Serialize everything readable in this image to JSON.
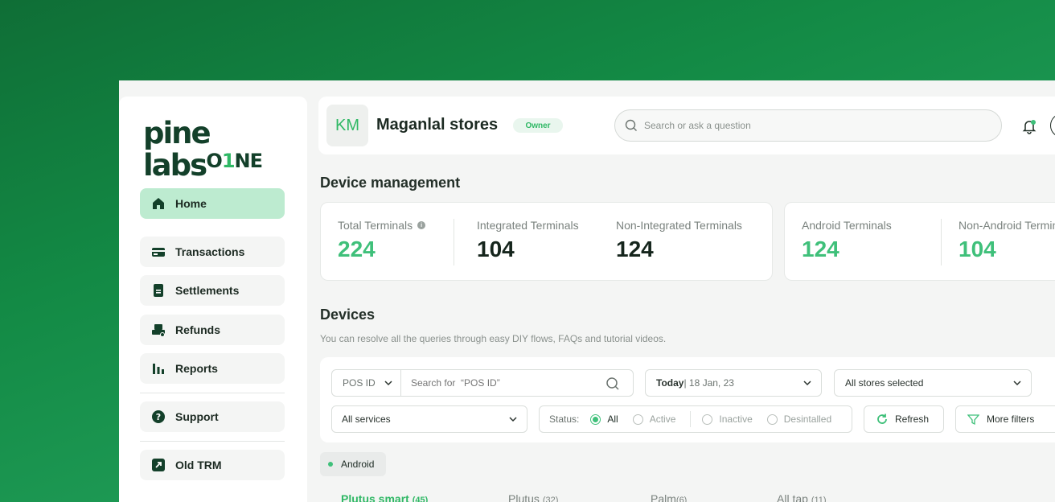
{
  "brand": {
    "logo_top": "pine labs",
    "logo_bottom_a": "O",
    "logo_bottom_b": "1",
    "logo_bottom_c": "NE"
  },
  "sidebar": {
    "items": [
      {
        "label": "Home",
        "icon": "home-icon",
        "active": true
      },
      {
        "label": "Transactions",
        "icon": "card-icon"
      },
      {
        "label": "Settlements",
        "icon": "document-icon"
      },
      {
        "label": "Refunds",
        "icon": "refund-icon"
      },
      {
        "label": "Reports",
        "icon": "bar-chart-icon"
      },
      {
        "label": "Support",
        "icon": "help-icon"
      },
      {
        "label": "Old TRM",
        "icon": "external-link-icon"
      }
    ]
  },
  "header": {
    "initials": "KM",
    "store_name": "Maganlal stores",
    "role_badge": "Owner",
    "search_placeholder": "Search or ask a question"
  },
  "device_management": {
    "title": "Device management",
    "stats_left": [
      {
        "label": "Total Terminals",
        "value": "224",
        "color": "#3fc07a"
      },
      {
        "label": "Integrated Terminals",
        "value": "104",
        "color": "#15251c"
      },
      {
        "label": "Non-Integrated Terminals",
        "value": "124",
        "color": "#15251c"
      }
    ],
    "stats_right": [
      {
        "label": "Android Terminals",
        "value": "124",
        "color": "#3fc07a"
      },
      {
        "label": "Non-Android Terminals",
        "value": "104",
        "color": "#3fc07a"
      }
    ]
  },
  "devices": {
    "title": "Devices",
    "subtitle": "You can resolve all the queries through easy DIY flows, FAQs and tutorial videos.",
    "filters": {
      "pos_select": "POS ID",
      "pos_search_placeholder": "Search for  “POS ID”",
      "date_bold": "Today",
      "date_rest": " | 18 Jan, 23",
      "stores": "All stores selected",
      "services": "All services",
      "status_label": "Status:",
      "status_options": [
        "All",
        "Active",
        "Inactive",
        "Desintalled"
      ],
      "status_selected": "All",
      "refresh": "Refresh",
      "more_filters": "More filters"
    },
    "platform_chip": "Android",
    "tabs": [
      {
        "name": "Plutus smart",
        "count": "(45)",
        "active": true
      },
      {
        "name": "Plutus",
        "count": "(32)"
      },
      {
        "name": "Palm",
        "count": "(6)"
      },
      {
        "name": "All tap",
        "count": "(11)"
      }
    ]
  },
  "colors": {
    "accent": "#3fc07a",
    "brand_dark": "#13402a",
    "active_nav": "#bdebd0"
  }
}
